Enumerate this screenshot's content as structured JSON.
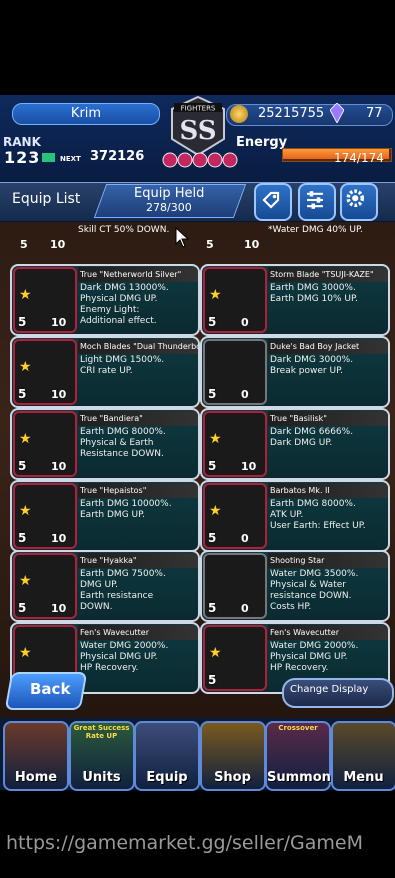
{
  "header": {
    "player_name": "Krim",
    "rank_label": "RANK",
    "rank_value": "123",
    "next_label": "NEXT",
    "exp_value": "372126",
    "logo_text": "FIGHTERS",
    "logo_grade": "SS",
    "coins": "25215755",
    "gems": "77",
    "energy_label": "Energy",
    "energy_value": "174/174",
    "energy_fraction": 1.0
  },
  "equip_bar": {
    "title": "Equip List",
    "held_label": "Equip Held",
    "held_value": "278/300"
  },
  "cards": [
    {
      "title": "True \"Netherworld Silver\"",
      "desc": "Dark DMG 13000%.\nPhysical DMG UP.\nEnemy Light:\nAdditional effect.",
      "stars": "5",
      "level": "10",
      "frame": "red"
    },
    {
      "title": "Storm Blade \"TSUJI-KAZE\"",
      "desc": "Earth DMG 3000%.\nEarth DMG 10% UP.",
      "stars": "5",
      "level": "0",
      "frame": "red"
    },
    {
      "title": "Moch Blades \"Dual Thunderbolts\"",
      "desc": "Light DMG 1500%.\nCRI rate UP.",
      "stars": "5",
      "level": "10",
      "frame": "red"
    },
    {
      "title": "Duke's Bad Boy Jacket",
      "desc": "Dark DMG 3000%.\nBreak power UP.",
      "stars": "5",
      "level": "0",
      "frame": "silver"
    },
    {
      "title": "True \"Bandiera\"",
      "desc": "Earth DMG 8000%.\nPhysical & Earth\nResistance DOWN.",
      "stars": "5",
      "level": "10",
      "frame": "red"
    },
    {
      "title": "True \"Basilisk\"",
      "desc": "Dark DMG 6666%.\nDark DMG UP.",
      "stars": "5",
      "level": "10",
      "frame": "red"
    },
    {
      "title": "True \"Hepaistos\"",
      "desc": "Earth DMG 10000%.\nEarth DMG UP.",
      "stars": "5",
      "level": "10",
      "frame": "red"
    },
    {
      "title": "Barbatos Mk. II",
      "desc": "Earth DMG 8000%.\nATK UP.\nUser Earth: Effect UP.",
      "stars": "5",
      "level": "0",
      "frame": "red"
    },
    {
      "title": "True \"Hyakka\"",
      "desc": "Earth DMG 7500%.\nDMG UP.\nEarth resistance\nDOWN.",
      "stars": "5",
      "level": "10",
      "frame": "red"
    },
    {
      "title": "Shooting Star",
      "desc": "Water DMG 3500%.\nPhysical & Water\nresistance DOWN.\nCosts HP.",
      "stars": "5",
      "level": "0",
      "frame": "silver"
    },
    {
      "title": "Fen's Wavecutter",
      "desc": "Water DMG 2000%.\nPhysical DMG UP.\nHP Recovery.",
      "stars": "5",
      "level": "",
      "frame": "red"
    },
    {
      "title": "Fen's Wavecutter",
      "desc": "Water DMG 2000%.\nPhysical DMG UP.\nHP Recovery.",
      "stars": "5",
      "level": "",
      "frame": "red"
    }
  ],
  "partial_top": {
    "left_desc": "Skill CT 50% DOWN.",
    "right_desc": "*Water DMG 40% UP.",
    "left_stars": "5",
    "left_level": "10",
    "right_stars": "5",
    "right_level": "10"
  },
  "controls": {
    "back_label": "Back",
    "change_display_label": "Change Display"
  },
  "nav": {
    "items": [
      {
        "label": "Home",
        "badge": ""
      },
      {
        "label": "Units",
        "badge": "Great Success Rate UP"
      },
      {
        "label": "Equip",
        "badge": ""
      },
      {
        "label": "Shop",
        "badge": ""
      },
      {
        "label": "Summon",
        "badge": "Crossover"
      },
      {
        "label": "Menu",
        "badge": ""
      }
    ]
  },
  "watermark": "https://gamemarket.gg/seller/GameM",
  "colors": {
    "accent": "#2f72c8",
    "frame_red": "#b0203a",
    "card_bg": "#0e3a40"
  }
}
